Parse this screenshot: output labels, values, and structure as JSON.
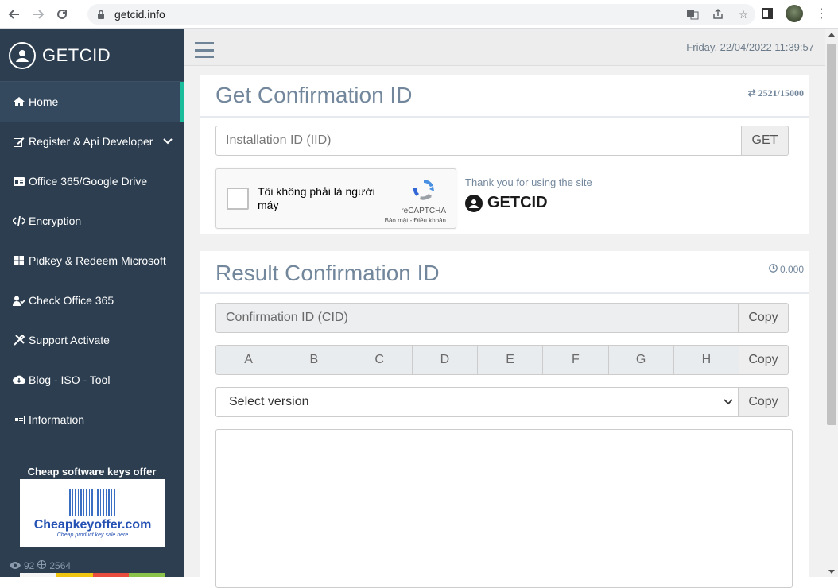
{
  "browser": {
    "url": "getcid.info",
    "back_icon": "arrow-left-icon",
    "forward_icon": "arrow-right-icon",
    "reload_icon": "reload-icon"
  },
  "sidebar": {
    "brand": "GETCID",
    "items": [
      {
        "label": "Home",
        "icon": "home-icon",
        "active": true
      },
      {
        "label": "Register & Api Developer",
        "icon": "edit-icon",
        "has_submenu": true
      },
      {
        "label": "Office 365/Google Drive",
        "icon": "id-card-icon"
      },
      {
        "label": "Encryption",
        "icon": "code-icon"
      },
      {
        "label": "Pidkey & Redeem Microsoft",
        "icon": "windows-icon"
      },
      {
        "label": "Check Office 365",
        "icon": "user-check-icon"
      },
      {
        "label": "Support Activate",
        "icon": "tools-icon"
      },
      {
        "label": "Blog - ISO - Tool",
        "icon": "cloud-download-icon"
      },
      {
        "label": "Information",
        "icon": "info-card-icon"
      }
    ],
    "promo_title": "Cheap software keys offer",
    "promo_name": "Cheapkeyoffer.com",
    "promo_tagline": "Cheap product key sale here",
    "stats": {
      "views": "92",
      "total": "2564"
    }
  },
  "topbar": {
    "datetime": "Friday, 22/04/2022 11:39:57"
  },
  "get_panel": {
    "title": "Get Confirmation ID",
    "counter": "2521/15000",
    "iid_placeholder": "Installation ID (IID)",
    "get_button": "GET",
    "recaptcha_label": "Tôi không phải là người máy",
    "recaptcha_brand": "reCAPTCHA",
    "recaptcha_legal": "Bảo mật - Điều khoản",
    "thanks_text": "Thank you for using the site",
    "thanks_brand": "GETCID"
  },
  "result_panel": {
    "title": "Result Confirmation ID",
    "timer": "0.000",
    "cid_placeholder": "Confirmation ID (CID)",
    "copy_label": "Copy",
    "blocks": [
      "A",
      "B",
      "C",
      "D",
      "E",
      "F",
      "G",
      "H"
    ],
    "select_value": "Select version"
  },
  "colors": {
    "sidebar_bg": "#2c3e50",
    "active_accent": "#1abc9c",
    "heading": "#73879c"
  }
}
